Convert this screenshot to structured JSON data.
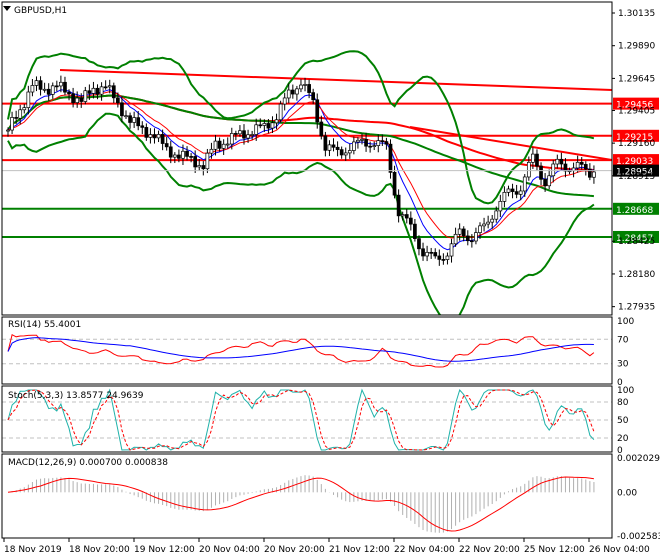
{
  "chart_data": {
    "type": "candlestick",
    "title": "GBPUSD,H1",
    "closes": [
      1.29258,
      1.29408,
      1.29596,
      1.29558,
      1.29596,
      1.29521,
      1.29483,
      1.29558,
      1.29596,
      1.29446,
      1.29333,
      1.29258,
      1.29221,
      1.29109,
      1.29071,
      1.29034,
      1.28996,
      1.29146,
      1.29184,
      1.29221,
      1.29258,
      1.29273,
      1.29371,
      1.29521,
      1.29633,
      1.29446,
      1.29146,
      1.29071,
      1.29146,
      1.29146,
      1.29184,
      1.29109,
      1.28659,
      1.28509,
      1.28359,
      1.2827,
      1.28359,
      1.28472,
      1.28472,
      1.28509,
      1.28697,
      1.28772,
      1.28846,
      1.29034,
      1.28884,
      1.28996,
      1.28996,
      1.28959,
      1.28944
    ],
    "price_ticks": [
      "1.30135",
      "1.29890",
      "1.29645",
      "1.29405",
      "1.29160",
      "1.28915",
      "1.28425",
      "1.28180",
      "1.27935"
    ],
    "price_range": [
      1.2788,
      1.3032
    ],
    "levels": [
      {
        "value": "1.29456",
        "color": "#ff0000"
      },
      {
        "value": "1.29215",
        "color": "#ff0000"
      },
      {
        "value": "1.29033",
        "color": "#ff0000"
      },
      {
        "value": "1.28668",
        "color": "#008000"
      },
      {
        "value": "1.28457",
        "color": "#008000"
      }
    ],
    "current_price": "1.28954",
    "time_labels": [
      "18 Nov 2019",
      "18 Nov 20:00",
      "19 Nov 12:00",
      "20 Nov 04:00",
      "20 Nov 20:00",
      "21 Nov 12:00",
      "22 Nov 04:00",
      "22 Nov 20:00",
      "25 Nov 12:00",
      "26 Nov 04:00"
    ],
    "rsi": {
      "label": "RSI(14) 55.4001",
      "ticks": [
        "100",
        "70",
        "30",
        "0"
      ]
    },
    "stoch": {
      "label": "Stoch(5,3,3) 13.8577 24.9639",
      "ticks": [
        "100",
        "80",
        "50",
        "20",
        "0"
      ]
    },
    "macd": {
      "label": "MACD(12,26,9) 0.000700 0.000838",
      "ticks": [
        "0.002029",
        "0.00",
        "-0.002583"
      ],
      "range": [
        -0.002583,
        0.002029
      ]
    }
  }
}
